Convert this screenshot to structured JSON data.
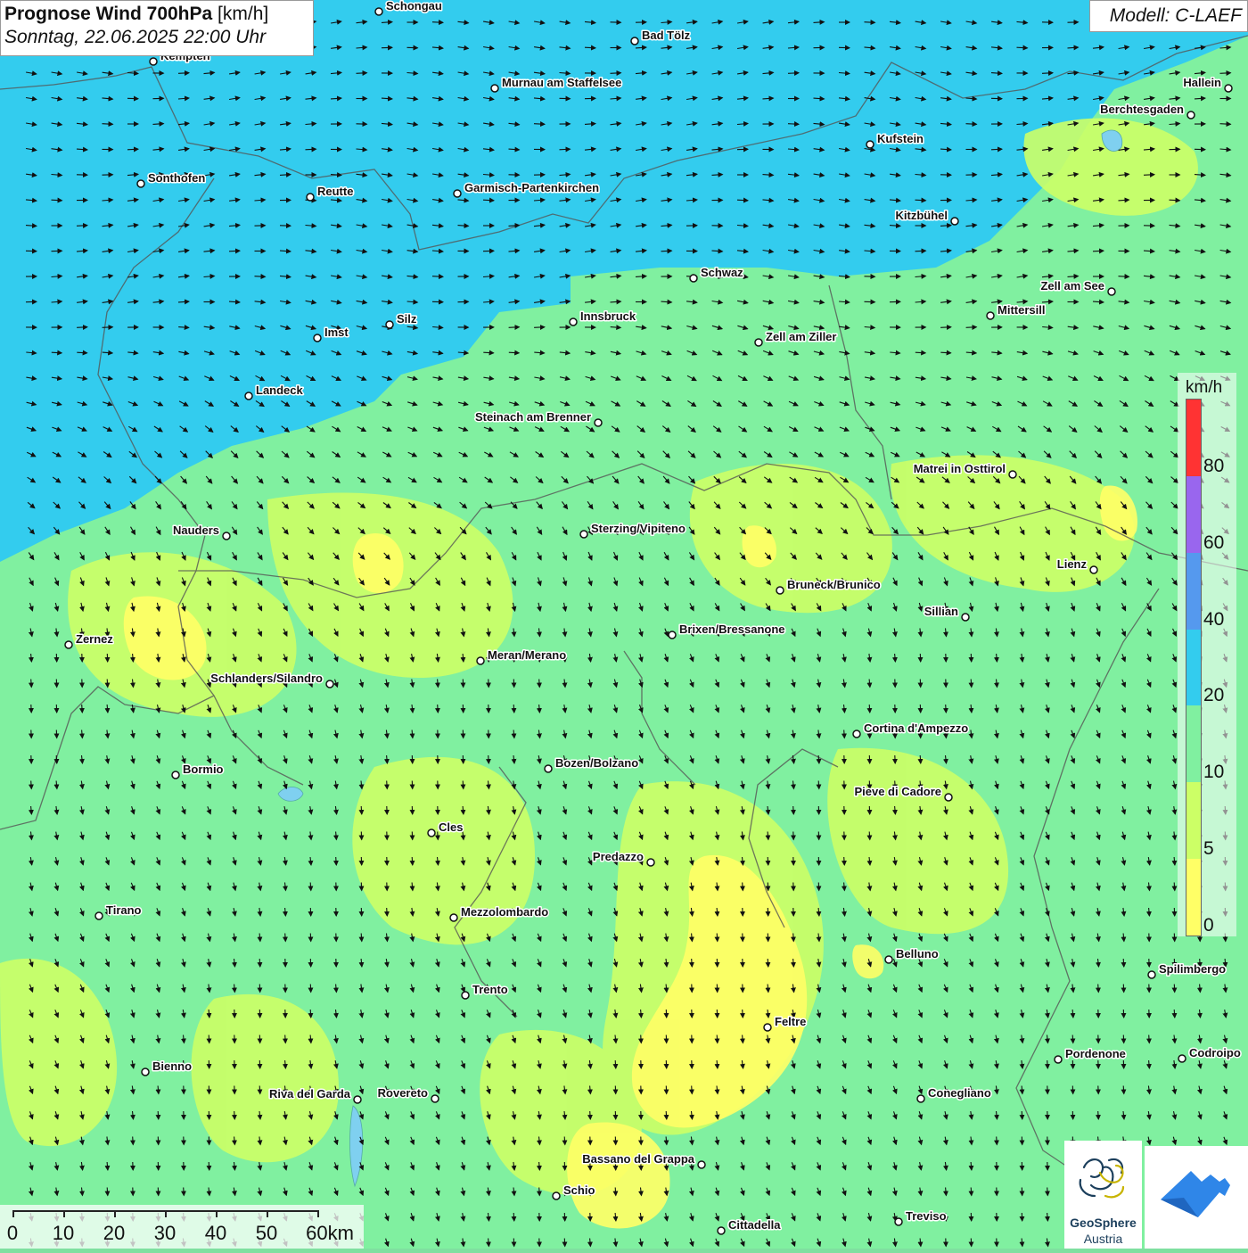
{
  "header": {
    "title_bold": "Prognose Wind 700hPa",
    "title_unit": "[km/h]",
    "subtitle": "Sonntag, 22.06.2025 22:00 Uhr",
    "model": "Modell: C-LAEF"
  },
  "legend": {
    "unit": "km/h",
    "classes": [
      {
        "from": 0,
        "to": 5,
        "color": "#ffff66"
      },
      {
        "from": 5,
        "to": 10,
        "color": "#ccff66"
      },
      {
        "from": 10,
        "to": 20,
        "color": "#80f0a0"
      },
      {
        "from": 20,
        "to": 40,
        "color": "#33ccee"
      },
      {
        "from": 40,
        "to": 60,
        "color": "#5599ee"
      },
      {
        "from": 60,
        "to": 80,
        "color": "#9966ee"
      },
      {
        "from": 80,
        "to": 100,
        "color": "#ff3333"
      }
    ],
    "tick_labels": [
      "0",
      "5",
      "10",
      "20",
      "40",
      "60",
      "80"
    ]
  },
  "scale_bar": {
    "labels": [
      "0",
      "10",
      "20",
      "30",
      "40",
      "50",
      "60km"
    ]
  },
  "cities": [
    {
      "name": "Schongau"
    },
    {
      "name": "Bad Tölz"
    },
    {
      "name": "Kempten"
    },
    {
      "name": "Murnau am Staffelsee"
    },
    {
      "name": "Hallein"
    },
    {
      "name": "Berchtesgaden"
    },
    {
      "name": "Kufstein"
    },
    {
      "name": "Sonthofen"
    },
    {
      "name": "Reutte"
    },
    {
      "name": "Garmisch-Partenkirchen"
    },
    {
      "name": "Kitzbühel"
    },
    {
      "name": "Schwaz"
    },
    {
      "name": "Zell am See"
    },
    {
      "name": "Mittersill"
    },
    {
      "name": "Innsbruck"
    },
    {
      "name": "Silz"
    },
    {
      "name": "Imst"
    },
    {
      "name": "Zell am Ziller"
    },
    {
      "name": "Landeck"
    },
    {
      "name": "Steinach am Brenner"
    },
    {
      "name": "Matrei in Osttirol"
    },
    {
      "name": "Nauders"
    },
    {
      "name": "Sterzing/Vipiteno"
    },
    {
      "name": "Lienz"
    },
    {
      "name": "Bruneck/Brunico"
    },
    {
      "name": "Sillian"
    },
    {
      "name": "Zernez"
    },
    {
      "name": "Brixen/Bressanone"
    },
    {
      "name": "Meran/Merano"
    },
    {
      "name": "Schlanders/Silandro"
    },
    {
      "name": "Cortina d'Ampezzo"
    },
    {
      "name": "Bozen/Bolzano"
    },
    {
      "name": "Bormio"
    },
    {
      "name": "Pieve di Cadore"
    },
    {
      "name": "Cles"
    },
    {
      "name": "Predazzo"
    },
    {
      "name": "Tirano"
    },
    {
      "name": "Mezzolombardo"
    },
    {
      "name": "Belluno"
    },
    {
      "name": "Spilimbergo"
    },
    {
      "name": "Trento"
    },
    {
      "name": "Feltre"
    },
    {
      "name": "Bienno"
    },
    {
      "name": "Pordenone"
    },
    {
      "name": "Codroipo"
    },
    {
      "name": "Riva del Garda"
    },
    {
      "name": "Rovereto"
    },
    {
      "name": "Conegliano"
    },
    {
      "name": "Bassano del Grappa"
    },
    {
      "name": "Schio"
    },
    {
      "name": "Treviso"
    },
    {
      "name": "Cittadella"
    }
  ],
  "logo": {
    "line1": "GeoSphere",
    "line2": "Austria"
  }
}
